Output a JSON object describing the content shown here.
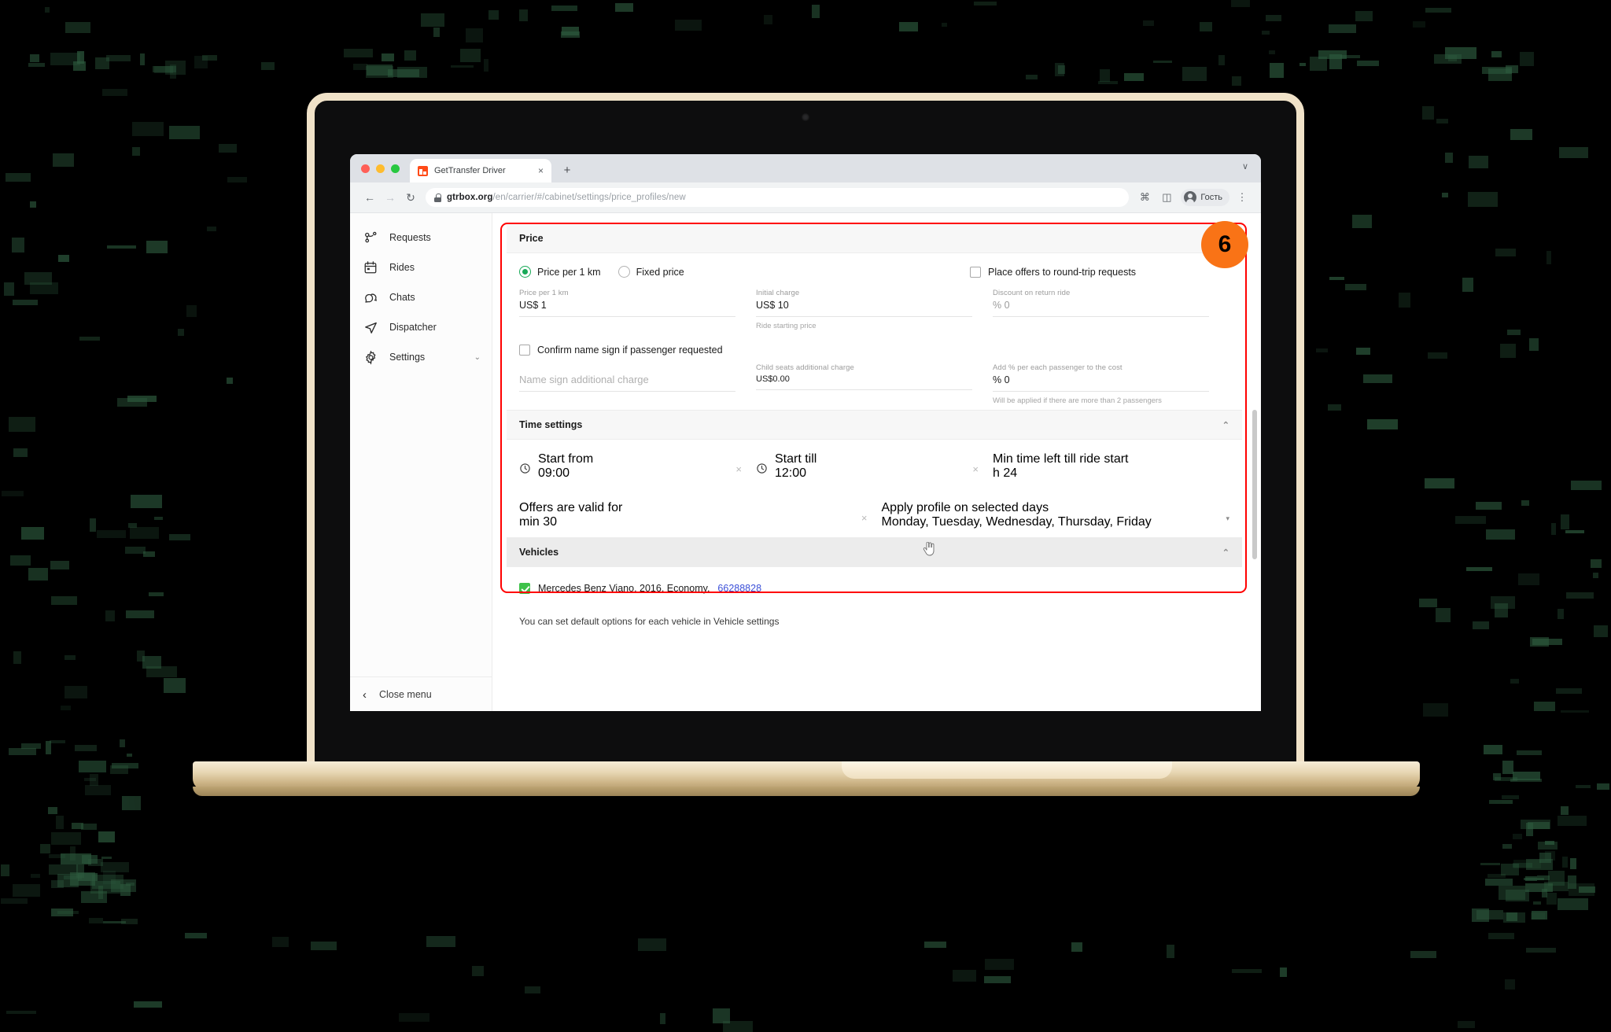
{
  "browser": {
    "tab_title": "GetTransfer Driver",
    "tab_close": "×",
    "new_tab": "+",
    "tabstrip_caret": "∨",
    "back": "←",
    "forward": "→",
    "reload": "↻",
    "url_domain": "gtrbox.org",
    "url_path": "/en/carrier/#/cabinet/settings/price_profiles/new",
    "command_icon": "⌘",
    "sidepanel_icon": "◫",
    "profile_name": "Гость",
    "menu_icon": "⋮"
  },
  "sidebar": {
    "items": [
      {
        "label": "Requests",
        "icon": "route-pin-icon"
      },
      {
        "label": "Rides",
        "icon": "calendar-icon"
      },
      {
        "label": "Chats",
        "icon": "chat-bubbles-icon"
      },
      {
        "label": "Dispatcher",
        "icon": "paper-plane-icon"
      },
      {
        "label": "Settings",
        "icon": "gear-icon",
        "chevron": "⌄"
      }
    ],
    "close_menu": "Close menu",
    "back_arrow": "‹"
  },
  "badge": {
    "number": "6",
    "color": "#f97316"
  },
  "price": {
    "title": "Price",
    "mode_options": [
      {
        "label": "Price per 1 km",
        "selected": true
      },
      {
        "label": "Fixed price",
        "selected": false
      }
    ],
    "round_trip_checkbox": {
      "label": "Place offers to round-trip requests",
      "checked": false
    },
    "fields": [
      {
        "label": "Price per 1 km",
        "value": "US$ 1",
        "help": ""
      },
      {
        "label": "Initial charge",
        "value": "US$ 10",
        "help": "Ride starting price"
      },
      {
        "label": "Discount on return ride",
        "value": "% 0",
        "help": "",
        "disabled": true
      }
    ],
    "name_sign_checkbox": {
      "label": "Confirm name sign if passenger requested",
      "checked": false
    },
    "fields2": [
      {
        "label": "",
        "value": "Name sign additional charge",
        "placeholder": true,
        "help": ""
      },
      {
        "label": "Child seats additional charge",
        "value": "US$0.00",
        "help": ""
      },
      {
        "label": "Add % per each passenger to the cost",
        "value": "% 0",
        "help": "Will be applied if there are more than 2 passengers"
      }
    ]
  },
  "time_settings": {
    "title": "Time settings",
    "collapse": "⌃",
    "row1": [
      {
        "label": "Start from",
        "value": "09:00",
        "icon": "clock-icon",
        "clear": "×"
      },
      {
        "label": "Start till",
        "value": "12:00",
        "icon": "clock-icon",
        "clear": "×"
      },
      {
        "label": "Min time left till ride start",
        "value": "h 24",
        "icon": "",
        "clear": ""
      }
    ],
    "row2": [
      {
        "label": "Offers are valid for",
        "value": "min 30",
        "clear": "×"
      },
      {
        "label": "Apply profile on selected days",
        "value": "Monday, Tuesday, Wednesday, Thursday, Friday",
        "caret": "▾"
      }
    ]
  },
  "vehicles": {
    "title": "Vehicles",
    "collapse": "⌃",
    "items": [
      {
        "checked": true,
        "text": "Mercedes Benz Viano, 2016, Economy, ",
        "link": "66288828"
      }
    ],
    "footer_note": "You can set default options for each vehicle in Vehicle settings"
  }
}
